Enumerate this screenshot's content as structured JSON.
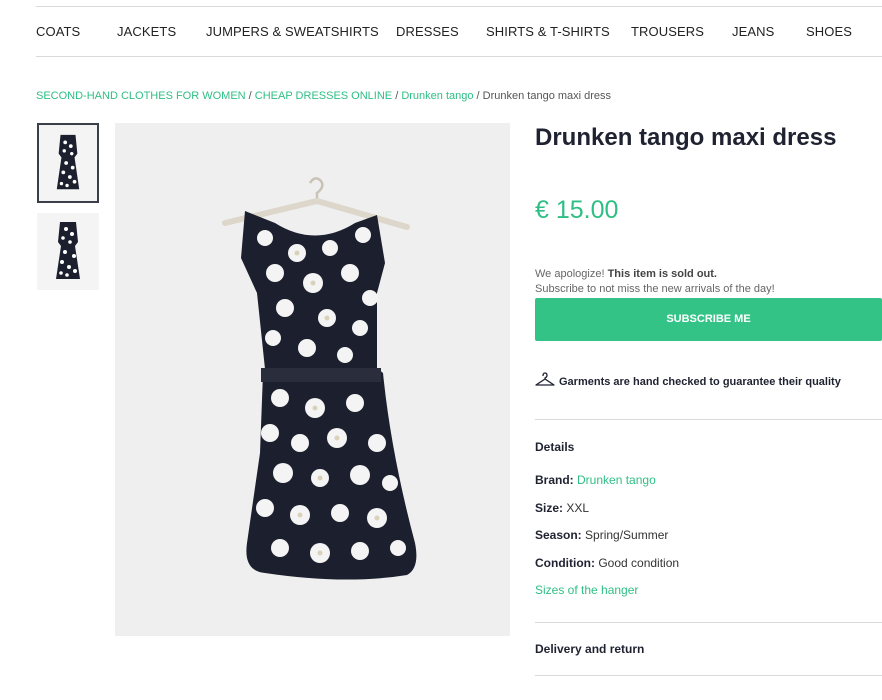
{
  "nav": {
    "items": [
      "COATS",
      "JACKETS",
      "JUMPERS & SWEATSHIRTS",
      "DRESSES",
      "SHIRTS & T-SHIRTS",
      "TROUSERS",
      "JEANS",
      "SHOES"
    ]
  },
  "breadcrumb": {
    "links": [
      "SECOND-HAND CLOTHES FOR WOMEN",
      "CHEAP DRESSES ONLINE",
      "Drunken tango"
    ],
    "separator": " / ",
    "current": "Drunken tango maxi dress"
  },
  "product": {
    "title": "Drunken tango maxi dress",
    "price": "€ 15.00",
    "soldout_prefix": "We apologize! ",
    "soldout_bold": "This item is sold out.",
    "soldout_line2": "Subscribe to not miss the new arrivals of the day!",
    "subscribe_label": "SUBSCRIBE ME",
    "quality_text": "Garments are hand checked to guarantee their quality"
  },
  "details": {
    "heading": "Details",
    "brand_label": "Brand:",
    "brand_value": "Drunken tango",
    "size_label": "Size:",
    "size_value": "XXL",
    "season_label": "Season:",
    "season_value": "Spring/Summer",
    "condition_label": "Condition:",
    "condition_value": "Good condition",
    "hanger_sizes_link": "Sizes of the hanger"
  },
  "delivery": {
    "heading": "Delivery and return"
  },
  "colors": {
    "accent": "#2fbf84",
    "button": "#34c387",
    "dress_dark": "#1c1f2e",
    "image_bg": "#efefef"
  }
}
